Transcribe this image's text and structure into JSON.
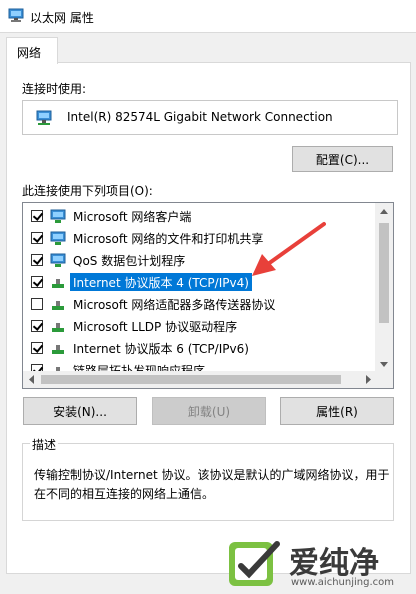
{
  "window": {
    "title": "以太网 属性"
  },
  "tab": {
    "label": "网络"
  },
  "connect_using": {
    "label": "连接时使用:",
    "adapter": "Intel(R) 82574L Gigabit Network Connection",
    "configure_button": "配置(C)..."
  },
  "items_section": {
    "label": "此连接使用下列项目(O):",
    "items": [
      {
        "label": "Microsoft 网络客户端",
        "checked": true,
        "icon": "network-client-icon"
      },
      {
        "label": "Microsoft 网络的文件和打印机共享",
        "checked": true,
        "icon": "file-share-icon"
      },
      {
        "label": "QoS 数据包计划程序",
        "checked": true,
        "icon": "qos-icon"
      },
      {
        "label": "Internet 协议版本 4 (TCP/IPv4)",
        "checked": true,
        "icon": "protocol-icon",
        "selected": true
      },
      {
        "label": "Microsoft 网络适配器多路传送器协议",
        "checked": false,
        "icon": "protocol-icon"
      },
      {
        "label": "Microsoft LLDP 协议驱动程序",
        "checked": true,
        "icon": "protocol-icon"
      },
      {
        "label": "Internet 协议版本 6 (TCP/IPv6)",
        "checked": true,
        "icon": "protocol-icon"
      },
      {
        "label": "链路层拓扑发现响应程序",
        "checked": true,
        "icon": "protocol-icon"
      }
    ]
  },
  "buttons": {
    "install": "安装(N)...",
    "uninstall": "卸载(U)",
    "properties": "属性(R)"
  },
  "description": {
    "legend": "描述",
    "text": "传输控制协议/Internet 协议。该协议是默认的广域网络协议，用于在不同的相互连接的网络上通信。"
  },
  "watermark": {
    "brand": "爱纯净",
    "url": "www.aichunjing.com"
  },
  "colors": {
    "selection": "#0078d7",
    "arrow": "#e8403a",
    "watermark_green": "#7cc142"
  }
}
